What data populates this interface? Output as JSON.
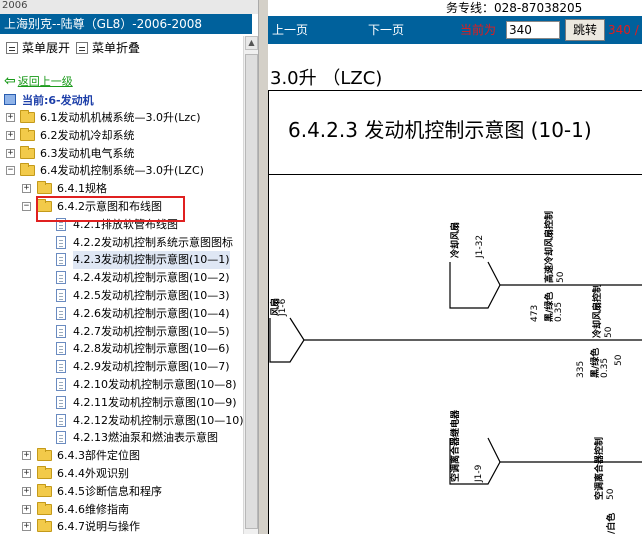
{
  "window": {
    "title": "2006"
  },
  "left_panel": {
    "book_title": "上海别克--陆尊（GL8）-2006-2008",
    "expand_label": "菜单展开",
    "collapse_label": "菜单折叠",
    "back_link": "返回上一级",
    "current_label": "当前:6-发动机",
    "tree": [
      {
        "label": "6.1发动机机械系统—3.0升(Lzc)",
        "toggle": "+"
      },
      {
        "label": "6.2发动机冷却系统",
        "toggle": "+"
      },
      {
        "label": "6.3发动机电气系统",
        "toggle": "+"
      },
      {
        "label": "6.4发动机控制系统—3.0升(LZC)",
        "toggle": "−"
      },
      {
        "label": "6.4.1规格",
        "toggle": "+"
      },
      {
        "label": "6.4.2示意图和布线图",
        "toggle": "−"
      },
      {
        "label": "4.2.1排放软管布线图"
      },
      {
        "label": "4.2.2发动机控制系统示意图图标"
      },
      {
        "label": "4.2.3发动机控制示意图(10—1)",
        "selected": true
      },
      {
        "label": "4.2.4发动机控制示意图(10—2)"
      },
      {
        "label": "4.2.5发动机控制示意图(10—3)"
      },
      {
        "label": "4.2.6发动机控制示意图(10—4)"
      },
      {
        "label": "4.2.7发动机控制示意图(10—5)"
      },
      {
        "label": "4.2.8发动机控制示意图(10—6)"
      },
      {
        "label": "4.2.9发动机控制示意图(10—7)"
      },
      {
        "label": "4.2.10发动机控制示意图(10—8)"
      },
      {
        "label": "4.2.11发动机控制示意图(10—9)"
      },
      {
        "label": "4.2.12发动机控制示意图(10—10)"
      },
      {
        "label": "4.2.13燃油泵和燃油表示意图"
      },
      {
        "label": "6.4.3部件定位图",
        "toggle": "+"
      },
      {
        "label": "6.4.4外观识别",
        "toggle": "+"
      },
      {
        "label": "6.4.5诊断信息和程序",
        "toggle": "+"
      },
      {
        "label": "6.4.6维修指南",
        "toggle": "+"
      },
      {
        "label": "6.4.7说明与操作",
        "toggle": "+"
      }
    ]
  },
  "right_panel": {
    "hotline": "务专线：028-87038205",
    "prev_label": "上一页",
    "next_label": "下一页",
    "current_page_label": "当前为",
    "current_page_value": "340",
    "go_label": "跳转",
    "page_total": "340 /",
    "doc_heading": "3.0升 （LZC)",
    "figure_title": "6.4.2.3 发动机控制示意图 (10-1)",
    "diagram": {
      "connector_top": "冷却风扇",
      "pin_top": "J1-32",
      "wire_top_label": "高速冷却风扇控制",
      "wire_top_num": "50",
      "wire_left": "风扇",
      "pin_left": "J1-6",
      "wire_473": "473",
      "wire_473_color": "黑/绿色",
      "wire_473_size": "0.35",
      "wire_473_func": "冷却风扇控制",
      "wire_473_num": "50",
      "wire_335": "335",
      "wire_335_color": "黑/绿色",
      "wire_335_size": "0.35",
      "wire_335_num": "50",
      "connector_bottom": "空调离合器继电器",
      "pin_bottom": "J1-9",
      "wire_bottom_func": "空调离合器控制",
      "wire_bottom_num": "50",
      "wire_bottom_color": "/白色"
    }
  }
}
